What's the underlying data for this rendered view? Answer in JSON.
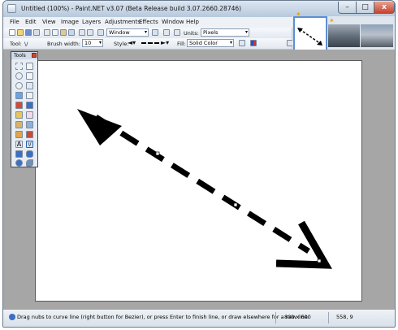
{
  "window": {
    "title": "Untitled (100%) - Paint.NET v3.07 (Beta Release build 3.07.2660.28746)",
    "minimize_glyph": "–",
    "maximize_glyph": "□",
    "close_glyph": "x"
  },
  "menu": [
    "File",
    "Edit",
    "View",
    "Image",
    "Layers",
    "Adjustments",
    "Effects",
    "Window",
    "Help"
  ],
  "toolbar": {
    "zoom_value": "Window",
    "units_label": "Units:",
    "units_value": "Pixels",
    "tool_label": "Tool:",
    "tool_value": "\\/",
    "brush_width_label": "Brush width:",
    "brush_width_value": "10",
    "style_label": "Style:",
    "fill_label": "Fill:",
    "fill_value": "Solid Color"
  },
  "tools_window": {
    "title": "Tools",
    "letter_tool": "A",
    "line_tool": "\\/"
  },
  "status": {
    "hint": "Drag nubs to curve line (right button for Bezier), or press Enter to finish line, or draw elsewhere for a new line.",
    "image_size": "800 x 600",
    "cursor_position": "558, 9"
  },
  "colors": {
    "accent": "#5c8fd6",
    "workspace": "#a6a6a6",
    "canvas": "#ffffff",
    "line": "#000000"
  }
}
